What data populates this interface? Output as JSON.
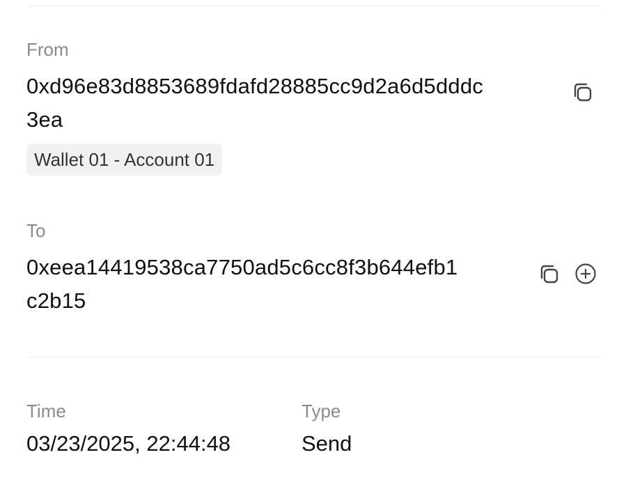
{
  "from": {
    "label": "From",
    "address_line1": "0xd96e83d8853689fdafd28885cc9d2a6d5dddc",
    "address_line2": "3ea",
    "account_badge": "Wallet 01 - Account 01"
  },
  "to": {
    "label": "To",
    "address_line1": "0xeea14419538ca7750ad5c6cc8f3b644efb1",
    "address_line2": "c2b15"
  },
  "details": {
    "time_label": "Time",
    "time_value": "03/23/2025, 22:44:48",
    "type_label": "Type",
    "type_value": "Send"
  },
  "icons": {
    "copy": "copy-icon",
    "add": "add-circle-icon"
  },
  "colors": {
    "label": "#8a8a8a",
    "text": "#111111",
    "badge_bg": "#f1f1f1",
    "icon": "#444444",
    "divider": "#ebebeb"
  }
}
